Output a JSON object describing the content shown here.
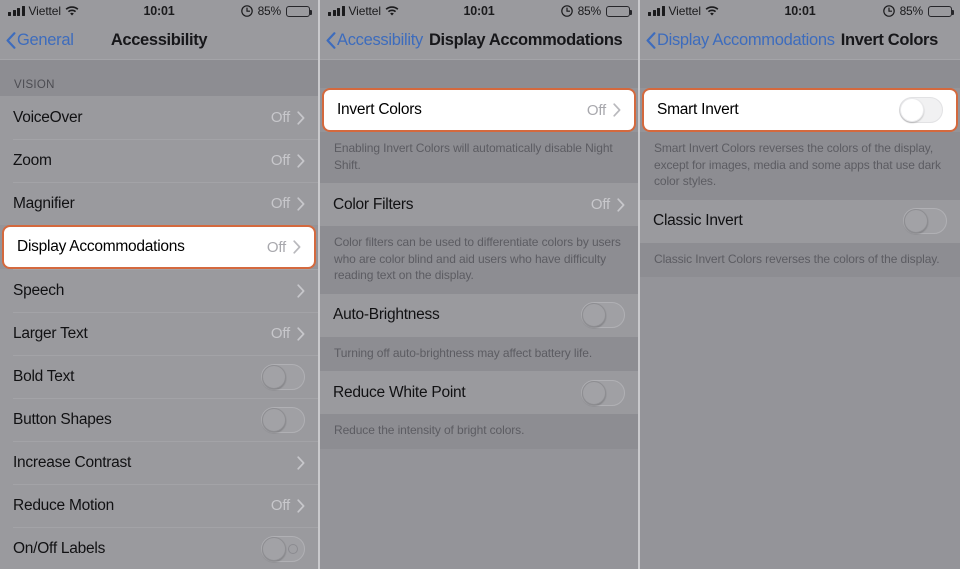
{
  "theme": {
    "highlight_border": "#d4693e",
    "link_blue": "#3d6cbd",
    "panel_bg": "#8d8d92",
    "row_bg": "#9a9a9e"
  },
  "status_bar": {
    "carrier": "Viettel",
    "time": "10:01",
    "battery_percent": "85%",
    "signal_icon": "cellular-bars-icon",
    "wifi_icon": "wifi-icon",
    "location_icon": "location-services-icon",
    "battery_icon": "battery-icon"
  },
  "panels": [
    {
      "nav": {
        "back_label": "General",
        "title": "Accessibility",
        "layout": "centered"
      },
      "section_header": "VISION",
      "rows": [
        {
          "label": "VoiceOver",
          "value": "Off",
          "accessory": "chevron",
          "highlighted": false
        },
        {
          "label": "Zoom",
          "value": "Off",
          "accessory": "chevron",
          "highlighted": false
        },
        {
          "label": "Magnifier",
          "value": "Off",
          "accessory": "chevron",
          "highlighted": false
        },
        {
          "label": "Display Accommodations",
          "value": "Off",
          "accessory": "chevron",
          "highlighted": true
        },
        {
          "label": "Speech",
          "value": "",
          "accessory": "chevron",
          "highlighted": false
        },
        {
          "label": "Larger Text",
          "value": "Off",
          "accessory": "chevron",
          "highlighted": false
        },
        {
          "label": "Bold Text",
          "value": "",
          "accessory": "toggle",
          "toggle_state": "off",
          "highlighted": false
        },
        {
          "label": "Button Shapes",
          "value": "",
          "accessory": "toggle",
          "toggle_state": "off",
          "highlighted": false
        },
        {
          "label": "Increase Contrast",
          "value": "",
          "accessory": "chevron",
          "highlighted": false
        },
        {
          "label": "Reduce Motion",
          "value": "Off",
          "accessory": "chevron",
          "highlighted": false
        },
        {
          "label": "On/Off Labels",
          "value": "",
          "accessory": "toggle",
          "toggle_state": "off",
          "toggle_has_label": true,
          "highlighted": false
        }
      ]
    },
    {
      "nav": {
        "back_label": "Accessibility",
        "title": "Display Accommodations",
        "layout": "inline"
      },
      "groups": [
        {
          "rows": [
            {
              "label": "Invert Colors",
              "value": "Off",
              "accessory": "chevron",
              "highlighted": true
            }
          ],
          "footer": "Enabling Invert Colors will automatically disable Night Shift."
        },
        {
          "rows": [
            {
              "label": "Color Filters",
              "value": "Off",
              "accessory": "chevron",
              "highlighted": false
            }
          ],
          "footer": "Color filters can be used to differentiate colors by users who are color blind and aid users who have difficulty reading text on the display."
        },
        {
          "rows": [
            {
              "label": "Auto-Brightness",
              "value": "",
              "accessory": "toggle",
              "toggle_state": "off",
              "highlighted": false
            }
          ],
          "footer": "Turning off auto-brightness may affect battery life."
        },
        {
          "rows": [
            {
              "label": "Reduce White Point",
              "value": "",
              "accessory": "toggle",
              "toggle_state": "off",
              "highlighted": false
            }
          ],
          "footer": "Reduce the intensity of bright colors."
        }
      ]
    },
    {
      "nav": {
        "back_label": "Display Accommodations",
        "title": "Invert Colors",
        "layout": "inline"
      },
      "groups": [
        {
          "rows": [
            {
              "label": "Smart Invert",
              "value": "",
              "accessory": "toggle",
              "toggle_state": "off",
              "highlighted": true
            }
          ],
          "footer": "Smart Invert Colors reverses the colors of the display, except for images, media and some apps that use dark color styles."
        },
        {
          "rows": [
            {
              "label": "Classic Invert",
              "value": "",
              "accessory": "toggle",
              "toggle_state": "off",
              "highlighted": false
            }
          ],
          "footer": "Classic Invert Colors reverses the colors of the display."
        }
      ]
    }
  ]
}
